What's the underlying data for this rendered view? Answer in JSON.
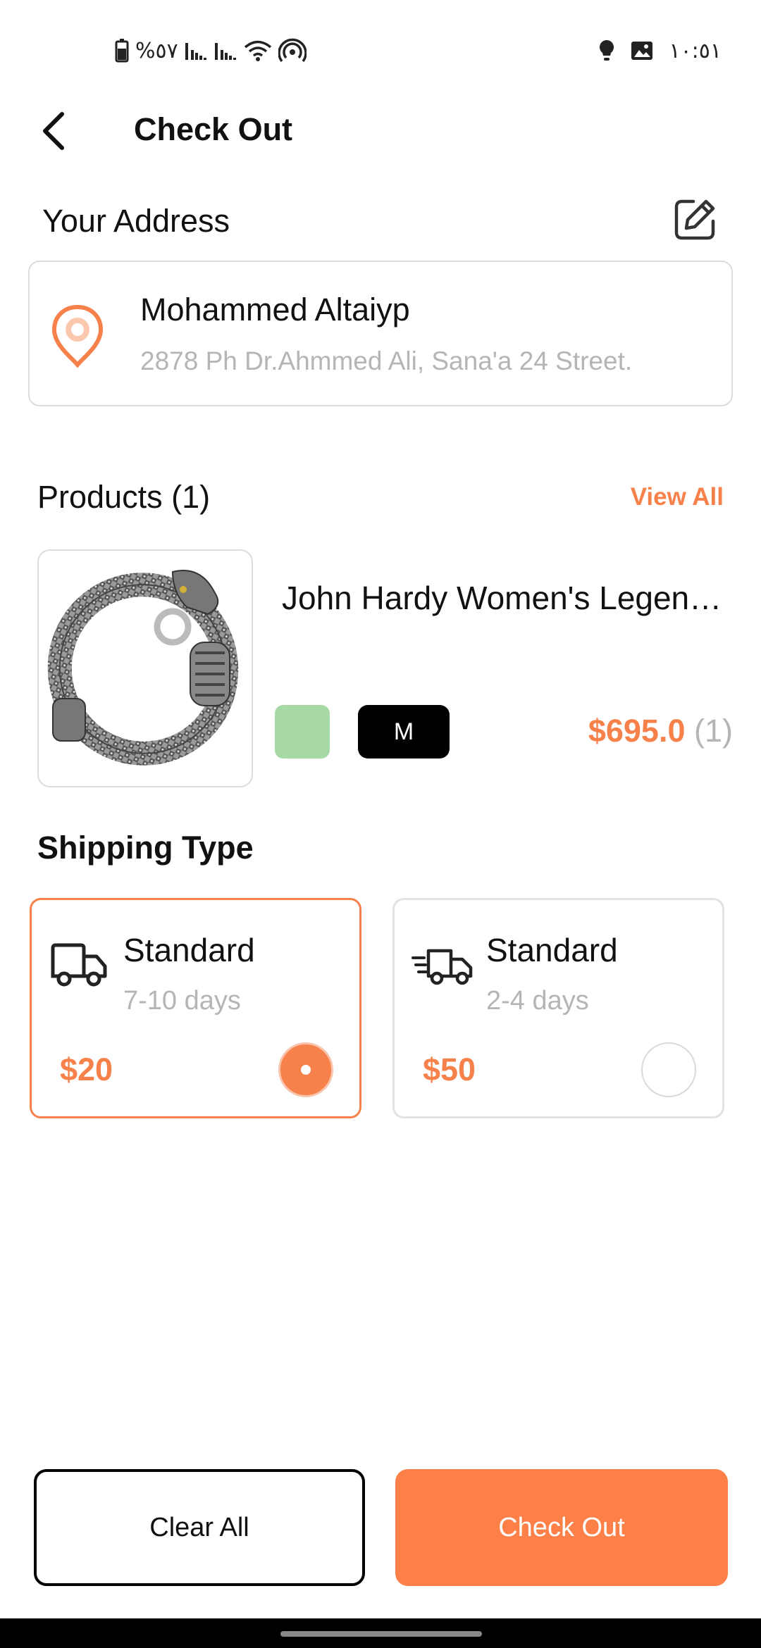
{
  "status_bar": {
    "battery_text": "%٥٧",
    "clock": "١٠:٥١"
  },
  "header": {
    "title": "Check Out",
    "back_icon": "arrow-left-icon"
  },
  "address": {
    "section_title": "Your Address",
    "edit_icon": "edit-pencil-icon",
    "pin_icon": "location-pin-icon",
    "name": "Mohammed Altaiyp",
    "line": "2878 Ph Dr.Ahmmed Ali, Sana'a 24 Street."
  },
  "products": {
    "section_title": "Products (1)",
    "view_all": "View All",
    "items": [
      {
        "name": "John Hardy Women's Legen…",
        "color": "#a6d9a6",
        "size": "M",
        "price": "$695.0",
        "qty": "(1)"
      }
    ]
  },
  "shipping": {
    "section_title": "Shipping Type",
    "options": [
      {
        "name": "Standard",
        "days": "7-10 days",
        "price": "$20",
        "selected": true,
        "icon": "truck-icon"
      },
      {
        "name": "Standard",
        "days": "2-4 days",
        "price": "$50",
        "selected": false,
        "icon": "fast-truck-icon"
      }
    ]
  },
  "footer": {
    "clear_label": "Clear All",
    "checkout_label": "Check Out"
  },
  "colors": {
    "accent": "#f7814a",
    "checkout_button": "#fd8048"
  }
}
